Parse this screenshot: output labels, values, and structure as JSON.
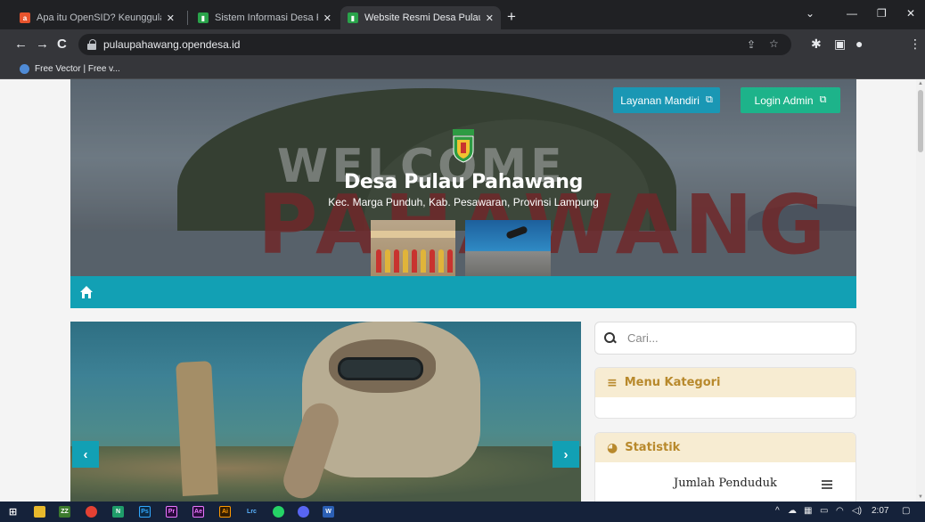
{
  "browser": {
    "tabs": [
      {
        "title": "Apa itu OpenSID? Keunggulan dan",
        "active": false,
        "favicon_color": "#e8542d"
      },
      {
        "title": "Sistem Informasi Desa Pulau Pahawang",
        "active": false,
        "favicon_color": "#29a34a"
      },
      {
        "title": "Website Resmi Desa Pulau Pahawang",
        "active": true,
        "favicon_color": "#29a34a"
      }
    ],
    "url": "pulaupahawang.opendesa.id",
    "bookmark": "Free Vector | Free v..."
  },
  "header": {
    "layanan_label": "Layanan Mandiri",
    "login_label": "Login Admin",
    "title": "Desa Pulau Pahawang",
    "subtitle": "Kec. Marga Punduh, Kab. Pesawaran, Provinsi Lampung",
    "bg_letters": "PAHAWANG",
    "bg_welcome": "WELCOME"
  },
  "nav": {
    "home_icon": "home-icon"
  },
  "slider": {
    "prev": "‹",
    "next": "›"
  },
  "sidebar": {
    "search_placeholder": "Cari...",
    "kategori_title": "Menu Kategori",
    "statistik_title": "Statistik",
    "statistik_item": "Jumlah Penduduk"
  },
  "taskbar": {
    "time": "2:07"
  },
  "colors": {
    "primary": "#12a0b4",
    "login": "#1db38a",
    "layanan": "#1a97b4",
    "widget_header": "#f7ecd2",
    "widget_title": "#b8892c"
  }
}
